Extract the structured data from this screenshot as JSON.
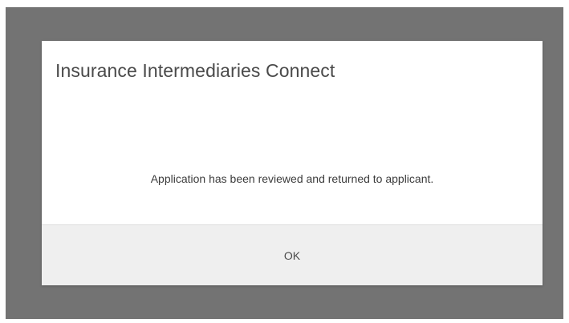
{
  "dialog": {
    "title": "Insurance Intermediaries Connect",
    "message": "Application has been reviewed and returned to applicant.",
    "ok_label": "OK"
  },
  "colors": {
    "overlay": "#737373",
    "dialog_background": "#ffffff",
    "footer_background": "#efefef",
    "title_text": "#4a4a4a",
    "body_text": "#3c3c3c"
  }
}
